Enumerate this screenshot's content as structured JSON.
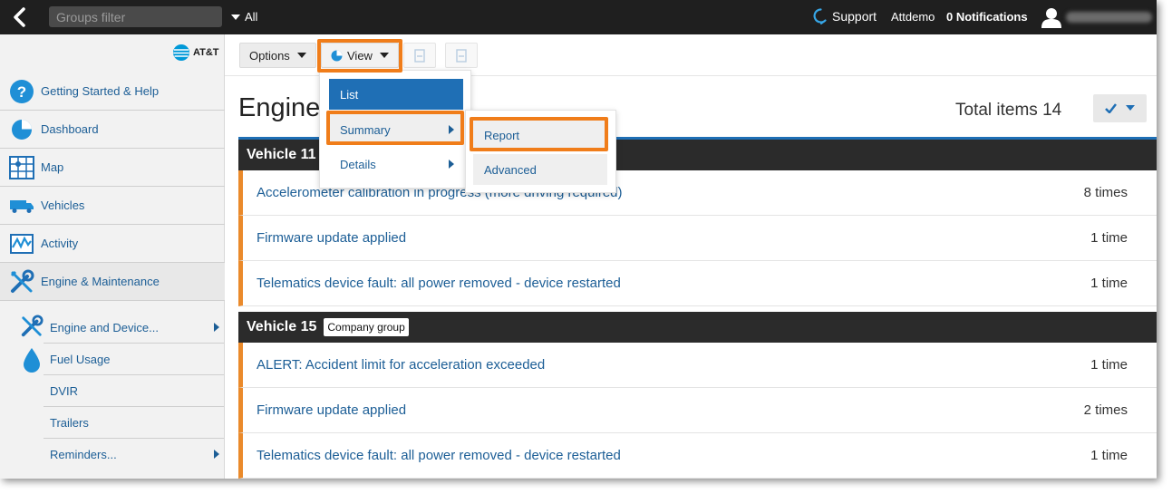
{
  "topbar": {
    "groups_filter_placeholder": "Groups filter",
    "scope": "All",
    "support": "Support",
    "user": "Attdemo",
    "notifications": "0 Notifications"
  },
  "sidebar": {
    "brand": "AT&T",
    "items": [
      {
        "label": "Getting Started & Help",
        "icon": "help-icon"
      },
      {
        "label": "Dashboard",
        "icon": "pie-chart-icon"
      },
      {
        "label": "Map",
        "icon": "map-icon"
      },
      {
        "label": "Vehicles",
        "icon": "truck-icon"
      },
      {
        "label": "Activity",
        "icon": "activity-icon"
      },
      {
        "label": "Engine & Maintenance",
        "icon": "wrench-icon"
      }
    ],
    "sub_items": [
      {
        "label": "Engine and Device...",
        "icon": "wrench-icon"
      },
      {
        "label": "Fuel Usage",
        "icon": "fuel-drop-icon"
      },
      {
        "label": "DVIR"
      },
      {
        "label": "Trailers"
      },
      {
        "label": "Reminders..."
      }
    ]
  },
  "toolbar": {
    "options_label": "Options",
    "view_label": "View"
  },
  "view_menu": {
    "items": [
      "List",
      "Summary",
      "Details"
    ],
    "summary_submenu": [
      "Report",
      "Advanced"
    ]
  },
  "page": {
    "title": "Engine",
    "total_items": "Total items 14"
  },
  "groups": [
    {
      "name": "Vehicle 11",
      "rows": [
        {
          "text": "Accelerometer calibration in progress (more driving required)",
          "count": "8 times"
        },
        {
          "text": "Firmware update applied",
          "count": "1 time"
        },
        {
          "text": "Telematics device fault: all power removed - device restarted",
          "count": "1 time"
        }
      ]
    },
    {
      "name": "Vehicle 15",
      "badge": "Company group",
      "rows": [
        {
          "text": "ALERT: Accident limit for acceleration exceeded",
          "count": "1 time"
        },
        {
          "text": "Firmware update applied",
          "count": "2 times"
        },
        {
          "text": "Telematics device fault: all power removed - device restarted",
          "count": "1 time"
        }
      ]
    }
  ],
  "colors": {
    "accent_blue": "#1f6fb5",
    "link_blue": "#1c5e96",
    "highlight_orange": "#f07d1a",
    "row_marker_orange": "#ea8a2b",
    "topbar_bg": "#1f1f1f"
  }
}
